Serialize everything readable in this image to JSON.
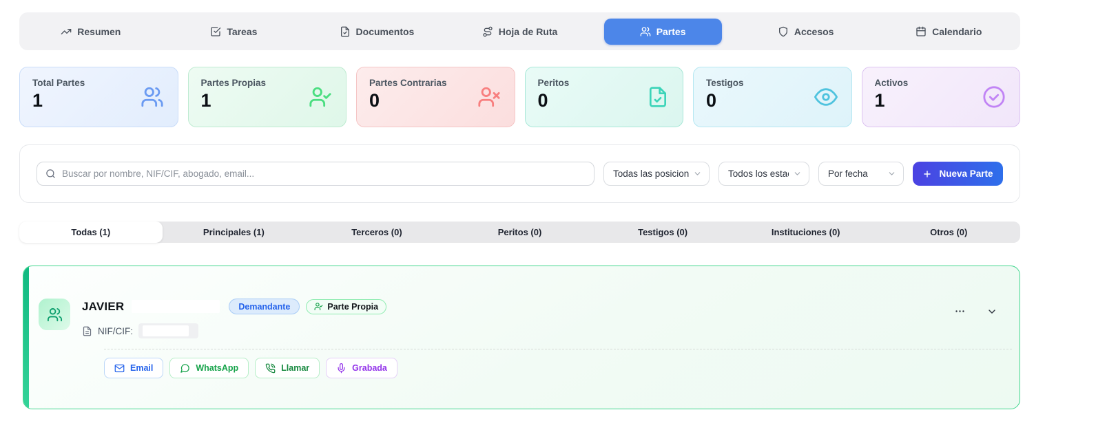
{
  "nav_tabs": [
    {
      "label": "Resumen",
      "icon": "trending-up-icon",
      "active": false
    },
    {
      "label": "Tareas",
      "icon": "check-square-icon",
      "active": false
    },
    {
      "label": "Documentos",
      "icon": "document-icon",
      "active": false
    },
    {
      "label": "Hoja de Ruta",
      "icon": "route-icon",
      "active": false
    },
    {
      "label": "Partes",
      "icon": "users-icon",
      "active": true
    },
    {
      "label": "Accesos",
      "icon": "shield-icon",
      "active": false
    },
    {
      "label": "Calendario",
      "icon": "calendar-icon",
      "active": false
    }
  ],
  "stats": [
    {
      "label": "Total Partes",
      "value": "1",
      "icon": "users-icon",
      "accent": "#6B9BF2"
    },
    {
      "label": "Partes Propias",
      "value": "1",
      "icon": "user-check-icon",
      "accent": "#4ADE80"
    },
    {
      "label": "Partes Contrarias",
      "value": "0",
      "icon": "user-x-icon",
      "accent": "#F87F7F"
    },
    {
      "label": "Peritos",
      "value": "0",
      "icon": "file-check-icon",
      "accent": "#3BD4B8"
    },
    {
      "label": "Testigos",
      "value": "0",
      "icon": "eye-icon",
      "accent": "#4FC3DE"
    },
    {
      "label": "Activos",
      "value": "1",
      "icon": "check-circle-icon",
      "accent": "#C184F5"
    }
  ],
  "search": {
    "placeholder": "Buscar por nombre, NIF/CIF, abogado, email..."
  },
  "filter_selects": [
    {
      "value": "Todas las posicion"
    },
    {
      "value": "Todos los estac"
    },
    {
      "value": "Por fecha"
    }
  ],
  "new_parte": {
    "label": "Nueva Parte"
  },
  "category_tabs": [
    {
      "label": "Todas (1)",
      "active": true
    },
    {
      "label": "Principales (1)",
      "active": false
    },
    {
      "label": "Terceros (0)",
      "active": false
    },
    {
      "label": "Peritos (0)",
      "active": false
    },
    {
      "label": "Testigos (0)",
      "active": false
    },
    {
      "label": "Instituciones (0)",
      "active": false
    },
    {
      "label": "Otros (0)",
      "active": false
    }
  ],
  "party": {
    "name": "JAVIER",
    "role_badge": "Demandante",
    "type_badge": "Parte Propia",
    "nif_label": "NIF/CIF:",
    "actions": [
      {
        "label": "Email",
        "icon": "mail-icon"
      },
      {
        "label": "WhatsApp",
        "icon": "chat-bubble-icon"
      },
      {
        "label": "Llamar",
        "icon": "phone-call-icon"
      },
      {
        "label": "Grabada",
        "icon": "microphone-icon"
      }
    ]
  },
  "colors": {
    "active_tab_blue": "#4C86E9",
    "new_button_gradient": [
      "#4B42E2",
      "#2E6FEB"
    ],
    "party_card_green": "#3ED68C",
    "badge_role_blue": "#2563EB",
    "badge_type_green": "#16A34A"
  }
}
